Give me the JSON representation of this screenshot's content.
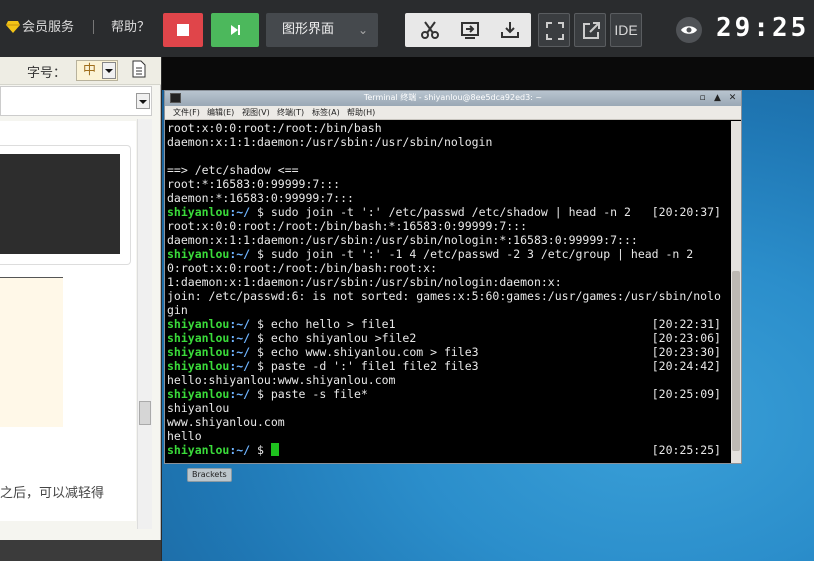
{
  "topbar": {
    "vip_label": "会员服务",
    "separator": "|",
    "help_label": "帮助？",
    "mode_select": "图形界面",
    "ide_label": "IDE",
    "timer": "29:25",
    "colors": {
      "stop": "#e0454a",
      "play": "#4cb85c",
      "bar": "#2a2c2e"
    }
  },
  "left_panel": {
    "font_label": "字号：",
    "font_size_value": "中",
    "truncated_text": "之后，可以减轻得"
  },
  "terminal": {
    "title": "Terminal 终端 - shiyanlou@8ee5dca92ed3: ~",
    "menu": [
      "文件(F)",
      "编辑(E)",
      "视图(V)",
      "终端(T)",
      "标签(A)",
      "帮助(H)"
    ],
    "lines": [
      {
        "text": "root:x:0:0:root:/root:/bin/bash"
      },
      {
        "text": "daemon:x:1:1:daemon:/usr/sbin:/usr/sbin/nologin"
      },
      {
        "text": ""
      },
      {
        "text": "==> /etc/shadow <=="
      },
      {
        "text": "root:*:16583:0:99999:7:::"
      },
      {
        "text": "daemon:*:16583:0:99999:7:::"
      },
      {
        "prompt": "shiyanlou",
        "path": ":~/",
        "cmd": " $ sudo join -t ':' /etc/passwd /etc/shadow | head -n 2",
        "ts": "[20:20:37]"
      },
      {
        "text": "root:x:0:0:root:/root:/bin/bash:*:16583:0:99999:7:::"
      },
      {
        "text": "daemon:x:1:1:daemon:/usr/sbin:/usr/sbin/nologin:*:16583:0:99999:7:::"
      },
      {
        "prompt": "shiyanlou",
        "path": ":~/",
        "cmd": " $ sudo join -t ':' -1 4 /etc/passwd -2 3 /etc/group | head -n 2",
        "ts": ""
      },
      {
        "text": "0:root:x:0:root:/root:/bin/bash:root:x:"
      },
      {
        "text": "1:daemon:x:1:daemon:/usr/sbin:/usr/sbin/nologin:daemon:x:"
      },
      {
        "text": "join: /etc/passwd:6: is not sorted: games:x:5:60:games:/usr/games:/usr/sbin/nolo"
      },
      {
        "text": "gin"
      },
      {
        "prompt": "shiyanlou",
        "path": ":~/",
        "cmd": " $ echo hello > file1",
        "ts": "[20:22:31]"
      },
      {
        "prompt": "shiyanlou",
        "path": ":~/",
        "cmd": " $ echo shiyanlou >file2",
        "ts": "[20:23:06]"
      },
      {
        "prompt": "shiyanlou",
        "path": ":~/",
        "cmd": " $ echo www.shiyanlou.com > file3",
        "ts": "[20:23:30]"
      },
      {
        "prompt": "shiyanlou",
        "path": ":~/",
        "cmd": " $ paste -d ':' file1 file2 file3",
        "ts": "[20:24:42]"
      },
      {
        "text": "hello:shiyanlou:www.shiyanlou.com"
      },
      {
        "prompt": "shiyanlou",
        "path": ":~/",
        "cmd": " $ paste -s file*",
        "ts": "[20:25:09]"
      },
      {
        "text": "shiyanlou"
      },
      {
        "text": "www.shiyanlou.com"
      },
      {
        "text": "hello"
      },
      {
        "prompt": "shiyanlou",
        "path": ":~/",
        "cmd": " $ ",
        "ts": "[20:25:25]",
        "cursor": true
      }
    ]
  },
  "desktop": {
    "taskbar_item": "Brackets"
  }
}
